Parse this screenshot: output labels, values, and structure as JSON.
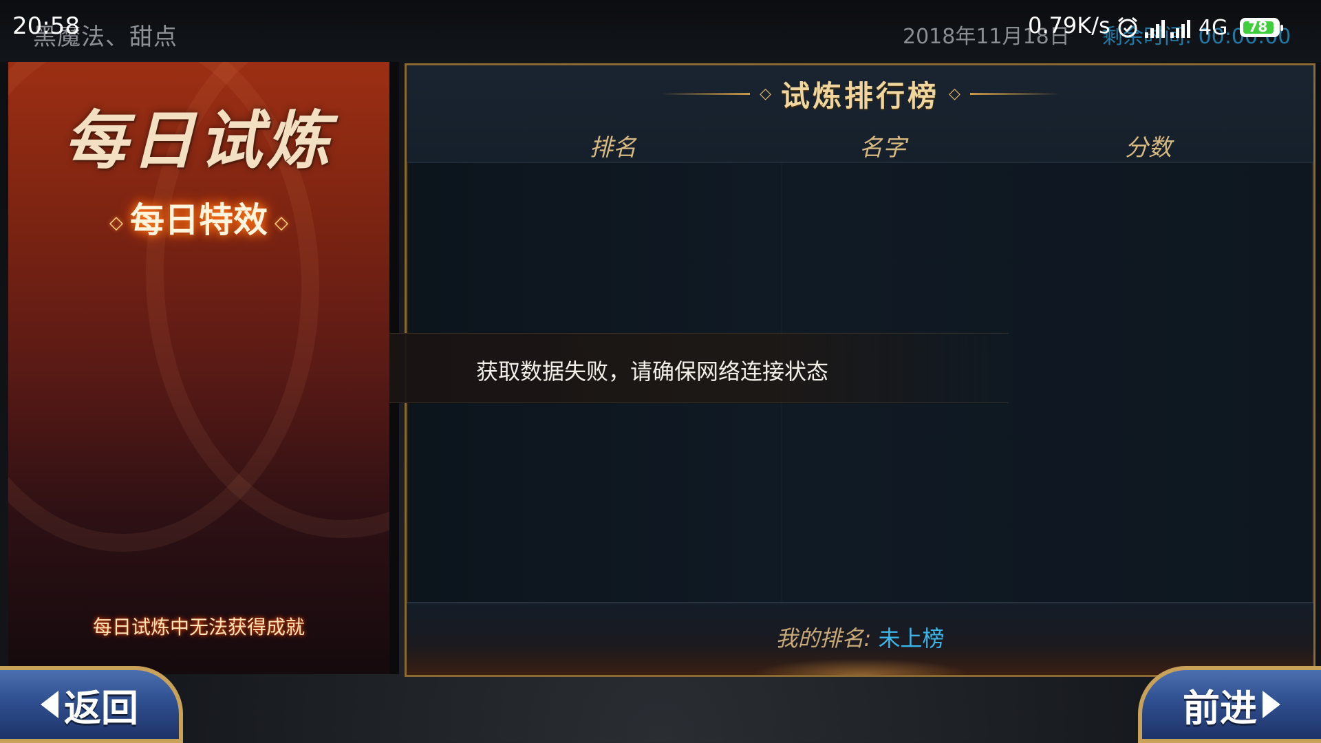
{
  "status_bar": {
    "time": "20:58",
    "breadcrumb": "黑魔法、甜点",
    "date": "2018年11月18日",
    "net_speed": "0.79K/s",
    "remaining_time": "剩余时间: 00:00:00",
    "network_type": "4G",
    "battery_level": "78",
    "icons": [
      "alarm-icon",
      "signal-icon",
      "signal-icon",
      "battery-icon"
    ]
  },
  "left_panel": {
    "title": "每日试炼",
    "subtitle": "每日特效",
    "note": "每日试炼中无法获得成就"
  },
  "leaderboard": {
    "title": "试炼排行榜",
    "columns": [
      "排名",
      "名字",
      "分数"
    ],
    "rows": [],
    "error_message": "获取数据失败，请确保网络连接状态",
    "my_rank_label": "我的排名:",
    "my_rank_value": "未上榜"
  },
  "nav": {
    "back_label": "返回",
    "forward_label": "前进"
  },
  "colors": {
    "accent_gold": "#d8b981",
    "rank_value": "#3cb6e8",
    "button_blue": "#2f4f8f"
  }
}
